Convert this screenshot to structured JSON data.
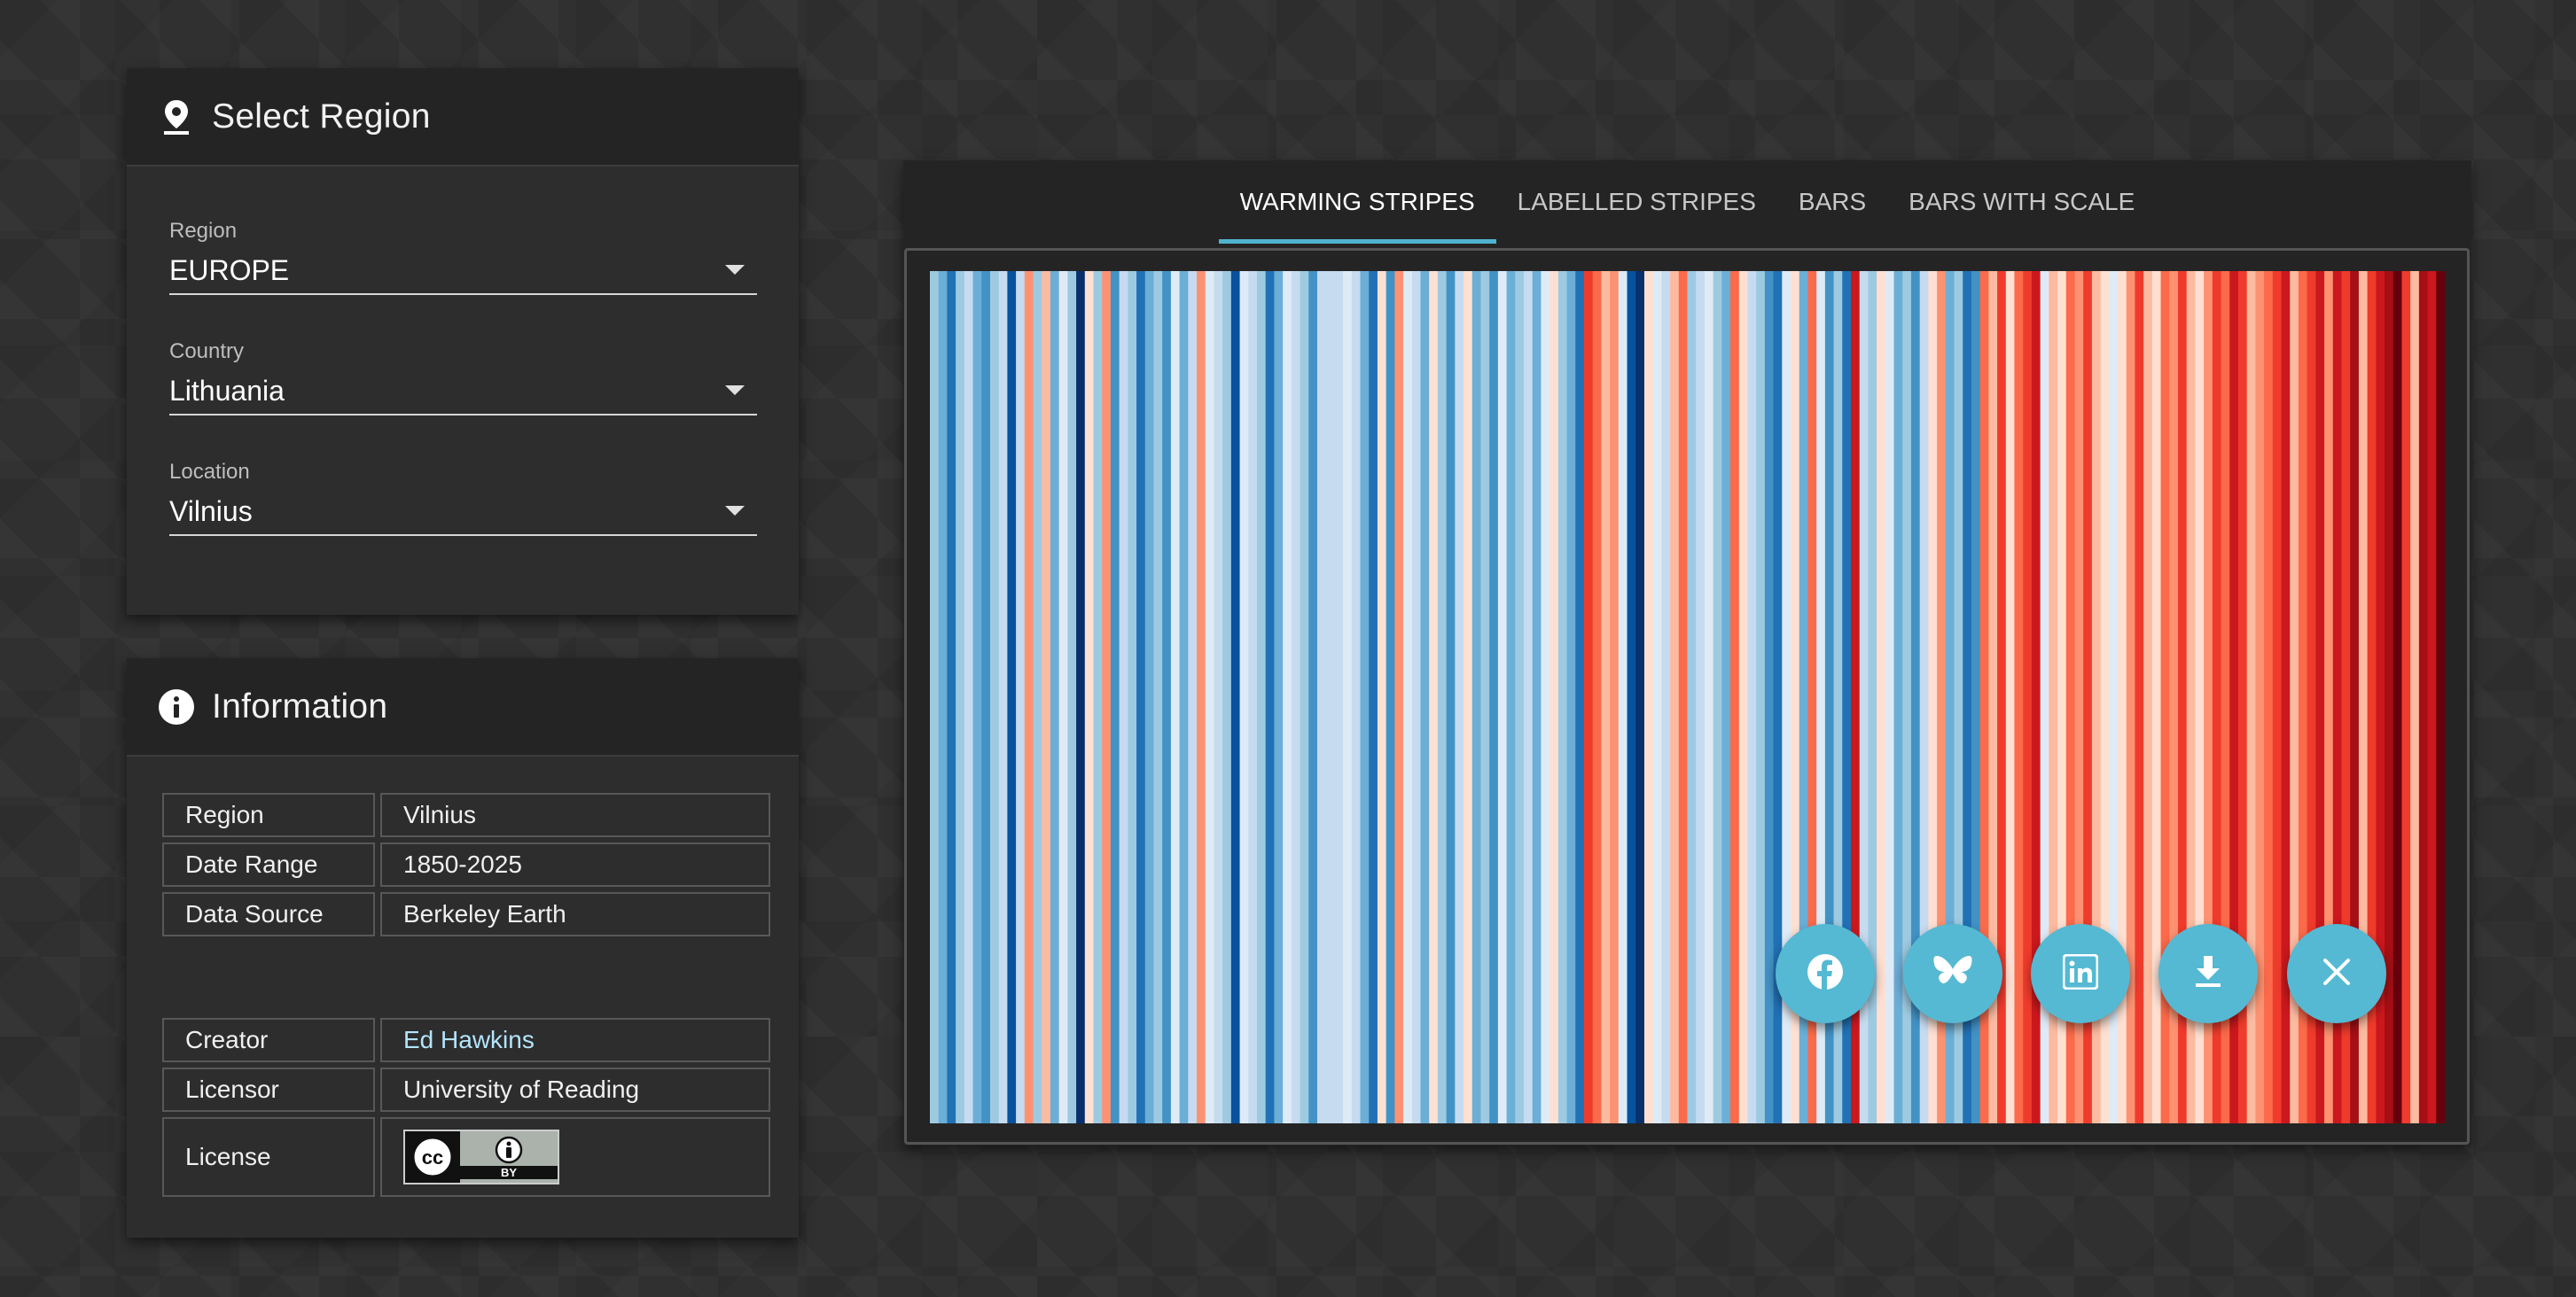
{
  "select_region": {
    "title": "Select Region",
    "icon": "location-pin-icon",
    "fields": [
      {
        "label": "Region",
        "value": "EUROPE"
      },
      {
        "label": "Country",
        "value": "Lithuania"
      },
      {
        "label": "Location",
        "value": "Vilnius"
      }
    ]
  },
  "information": {
    "title": "Information",
    "icon": "info-icon",
    "rows": [
      {
        "key": "Region",
        "value": "Vilnius"
      },
      {
        "key": "Date Range",
        "value": "1850-2025"
      },
      {
        "key": "Data Source",
        "value": "Berkeley Earth"
      }
    ],
    "credits": [
      {
        "key": "Creator",
        "value": "Ed Hawkins",
        "link": true
      },
      {
        "key": "Licensor",
        "value": "University of Reading"
      },
      {
        "key": "License",
        "value": "",
        "badge": "cc-by-badge-icon",
        "badge_text": "BY"
      }
    ]
  },
  "tabs": [
    {
      "label": "WARMING STRIPES",
      "active": true
    },
    {
      "label": "LABELLED STRIPES",
      "active": false
    },
    {
      "label": "BARS",
      "active": false
    },
    {
      "label": "BARS WITH SCALE",
      "active": false
    }
  ],
  "colors": {
    "accent": "#55b9d3",
    "tab_indicator": "#4fb3cf",
    "link": "#b3e5fc"
  },
  "share_buttons": [
    {
      "name": "facebook-share-button",
      "icon": "facebook-icon"
    },
    {
      "name": "bluesky-share-button",
      "icon": "butterfly-icon"
    },
    {
      "name": "linkedin-share-button",
      "icon": "linkedin-icon"
    },
    {
      "name": "download-button",
      "icon": "download-icon"
    },
    {
      "name": "close-share-button",
      "icon": "close-icon"
    }
  ],
  "chart_data": {
    "type": "heatmap",
    "title": "",
    "x_range": [
      1850,
      2025
    ],
    "palette": [
      "#08306b",
      "#08519c",
      "#2171b5",
      "#4292c6",
      "#6baed6",
      "#9ecae1",
      "#c6dbef",
      "#deebf7",
      "#fee0d2",
      "#fcbba1",
      "#fc9272",
      "#fb6a4a",
      "#ef3b2c",
      "#cb181d",
      "#a50f15",
      "#67000d"
    ],
    "anomaly_levels": [
      5,
      4,
      2,
      5,
      6,
      4,
      3,
      5,
      6,
      1,
      6,
      10,
      5,
      9,
      4,
      7,
      5,
      0,
      8,
      5,
      10,
      3,
      6,
      5,
      2,
      4,
      5,
      3,
      7,
      4,
      6,
      10,
      7,
      6,
      5,
      1,
      7,
      6,
      5,
      2,
      4,
      7,
      6,
      5,
      3,
      6,
      6,
      6,
      7,
      6,
      4,
      2,
      8,
      3,
      10,
      7,
      6,
      4,
      8,
      5,
      3,
      6,
      8,
      4,
      5,
      3,
      7,
      4,
      5,
      6,
      4,
      7,
      8,
      5,
      4,
      2,
      12,
      11,
      9,
      10,
      7,
      1,
      0,
      8,
      7,
      6,
      9,
      11,
      5,
      6,
      7,
      5,
      4,
      11,
      8,
      6,
      5,
      3,
      2,
      7,
      8,
      4,
      11,
      7,
      3,
      5,
      2,
      13,
      6,
      5,
      8,
      7,
      4,
      5,
      3,
      6,
      8,
      10,
      4,
      5,
      2,
      3,
      11,
      9,
      12,
      8,
      11,
      12,
      13,
      7,
      9,
      8,
      11,
      10,
      12,
      9,
      8,
      7,
      8,
      10,
      12,
      9,
      8,
      11,
      10,
      12,
      9,
      8,
      10,
      12,
      11,
      13,
      12,
      9,
      10,
      11,
      12,
      13,
      9,
      11,
      12,
      13,
      10,
      13,
      12,
      14,
      9,
      12,
      13,
      14,
      15,
      12,
      9,
      14,
      13,
      15
    ]
  }
}
